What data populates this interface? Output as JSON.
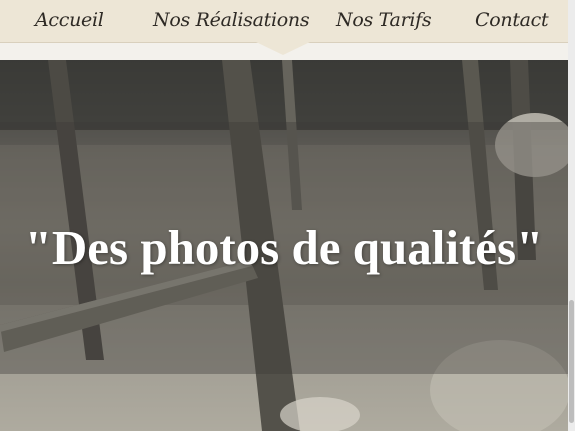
{
  "nav": {
    "items": [
      {
        "label": "Accueil"
      },
      {
        "label": "Nos Réalisations"
      },
      {
        "label": "Nos Tarifs"
      },
      {
        "label": "Contact"
      }
    ]
  },
  "hero": {
    "title": "\"Des photos de qualités\""
  },
  "colors": {
    "nav_background": "#ede6d6",
    "nav_text": "#2e2a25",
    "hero_title": "#ffffff"
  },
  "icons": [
    "scrollbar"
  ]
}
